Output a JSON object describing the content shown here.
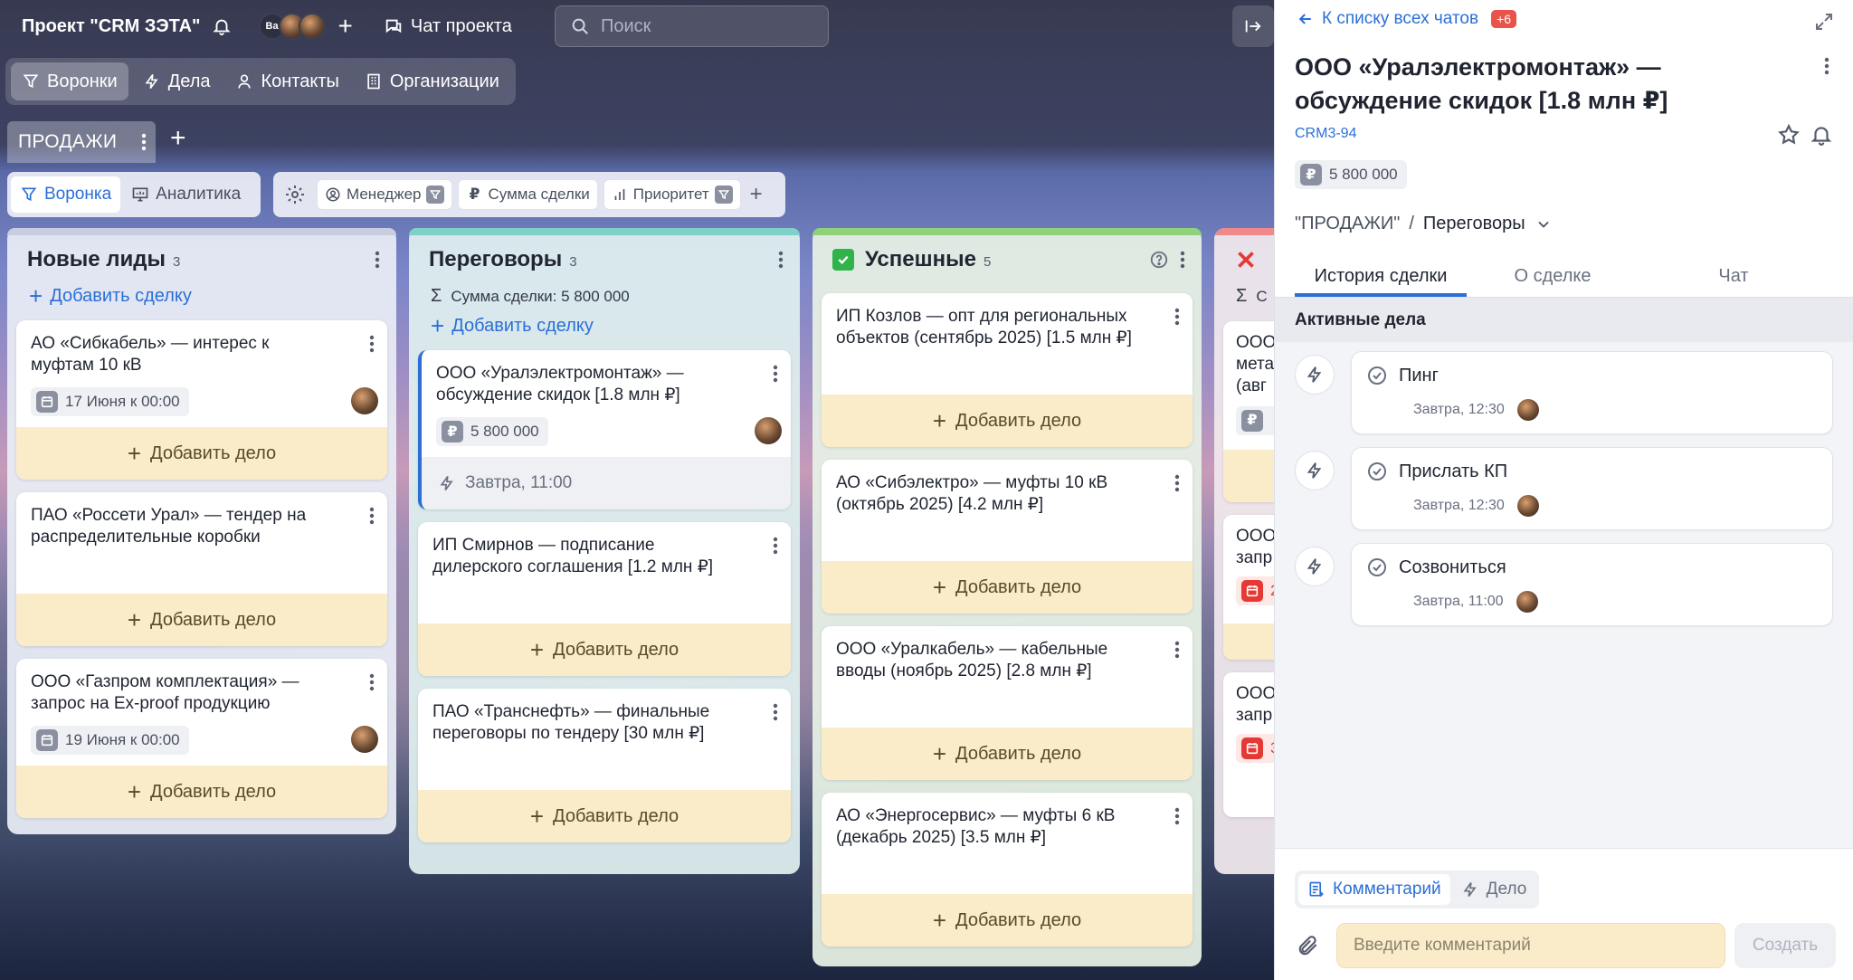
{
  "project": {
    "title": "Проект \"CRM ЗЭТА\"",
    "avatar_initials": "Ba",
    "chat_label": "Чат проекта"
  },
  "search": {
    "placeholder": "Поиск"
  },
  "nav": [
    {
      "label": "Воронки",
      "icon": "funnel-icon"
    },
    {
      "label": "Дела",
      "icon": "bolt-icon"
    },
    {
      "label": "Контакты",
      "icon": "person-icon"
    },
    {
      "label": "Организации",
      "icon": "building-icon"
    }
  ],
  "pipeline": {
    "tab_label": "ПРОДАЖИ"
  },
  "toolbar": {
    "views": [
      {
        "label": "Воронка"
      },
      {
        "label": "Аналитика"
      }
    ],
    "filters": [
      {
        "label": "Менеджер"
      },
      {
        "label": "Сумма сделки"
      },
      {
        "label": "Приоритет"
      }
    ]
  },
  "columns": {
    "new": {
      "title": "Новые лиды",
      "count": "3",
      "add_label": "Добавить сделку",
      "color": "#c9cde0"
    },
    "neg": {
      "title": "Переговоры",
      "count": "3",
      "sum_label": "Сумма сделки: 5 800 000",
      "add_label": "Добавить сделку",
      "color": "#7fd1c8"
    },
    "won": {
      "title": "Успешные",
      "count": "5",
      "color": "#8fd27a"
    },
    "lost": {
      "sum_label": "С",
      "color": "#f08a8a"
    }
  },
  "add_task_label": "Добавить дело",
  "cards": {
    "c1": {
      "title": "АО «Сибкабель» — интерес к муфтам 10 кВ",
      "date": "17 Июня к 00:00"
    },
    "c2": {
      "title": "ПАО «Россети Урал» — тендер на распределительные коробки"
    },
    "c3": {
      "title": "ООО «Газпром комплектация» — запрос на Ex-proof продукцию",
      "date": "19 Июня к 00:00"
    },
    "n1": {
      "title": "ООО «Уралэлектромонтаж» — обсуждение скидок [1.8 млн ₽]",
      "amount": "5 800 000",
      "next": "Завтра, 11:00"
    },
    "n2": {
      "title": "ИП Смирнов — подписание дилерского соглашения [1.2 млн ₽]"
    },
    "n3": {
      "title": "ПАО «Транснефть» — финальные переговоры по тендеру [30 млн ₽]"
    },
    "w1": {
      "title": "ИП Козлов — опт для региональных объектов (сентябрь 2025) [1.5 млн ₽]"
    },
    "w2": {
      "title": "АО «Сибэлектро» — муфты 10 кВ (октябрь 2025) [4.2 млн ₽]"
    },
    "w3": {
      "title": "ООО «Уралкабель» — кабельные вводы (ноябрь 2025) [2.8 млн ₽]"
    },
    "w4": {
      "title": "АО «Энергосервис» — муфты 6 кВ (декабрь 2025) [3.5 млн ₽]"
    },
    "l1": {
      "lines": [
        "ООО",
        "мета",
        "(авг"
      ]
    },
    "l2": {
      "lines": [
        "ООО",
        "запр",
        "2"
      ]
    },
    "l3": {
      "lines": [
        "ООО",
        "запр",
        "3"
      ]
    }
  },
  "panel": {
    "back_label": "К списку всех чатов",
    "back_badge": "+6",
    "title": "ООО «Уралэлектромонтаж» — обсуждение скидок [1.8 млн ₽]",
    "code": "CRM3-94",
    "amount": "5 800 000",
    "breadcrumb_pipeline": "\"ПРОДАЖИ\"",
    "breadcrumb_sep": "/",
    "breadcrumb_stage": "Переговоры",
    "tabs": [
      "История сделки",
      "О сделке",
      "Чат"
    ],
    "section_title": "Активные дела",
    "activities": [
      {
        "title": "Пинг",
        "time": "Завтра, 12:30"
      },
      {
        "title": "Прислать КП",
        "time": "Завтра, 12:30"
      },
      {
        "title": "Созвониться",
        "time": "Завтра, 11:00"
      }
    ],
    "composer": {
      "tabs": [
        "Комментарий",
        "Дело"
      ],
      "placeholder": "Введите комментарий",
      "submit": "Создать"
    }
  },
  "colors": {
    "accent": "#2b6fd6",
    "task_bg": "#fbecc9",
    "badge_red": "#e8534a",
    "lost_red": "#e53935",
    "won_green": "#2fb34a"
  }
}
